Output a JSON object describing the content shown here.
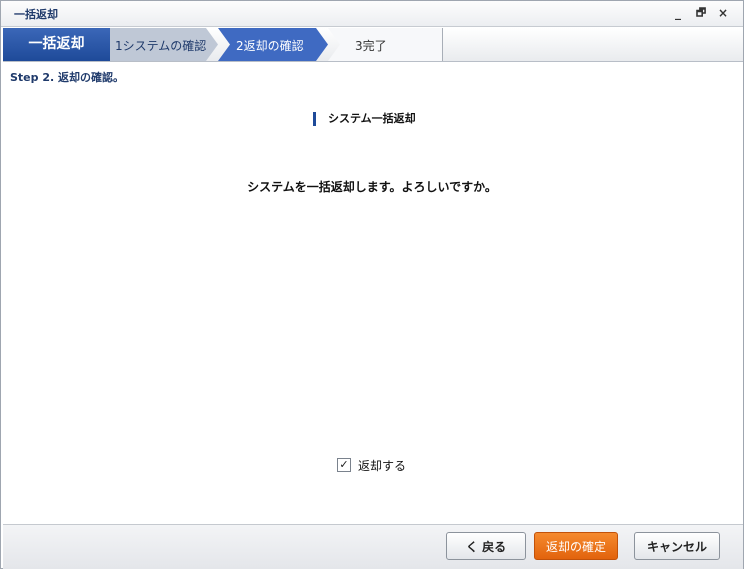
{
  "window": {
    "title": "一括返却",
    "controls": {
      "minimize": "_",
      "restore": "🗗",
      "close": "×"
    }
  },
  "steps": {
    "main": "一括返却",
    "items": [
      {
        "label": "1システムの確認"
      },
      {
        "label": "2返却の確認"
      },
      {
        "label": "3完了"
      }
    ]
  },
  "content": {
    "step_heading": "Step 2. 返却の確認。",
    "section_title": "システム一括返却",
    "message": "システムを一括返却します。よろしいですか。",
    "checkbox": {
      "label": "返却する",
      "checked": true,
      "mark": "✓"
    }
  },
  "footer": {
    "back": "く 戻る",
    "confirm": "返却の確定",
    "cancel": "キャンセル"
  },
  "colors": {
    "accent": "#1e4a99",
    "confirm": "#e2630d"
  }
}
